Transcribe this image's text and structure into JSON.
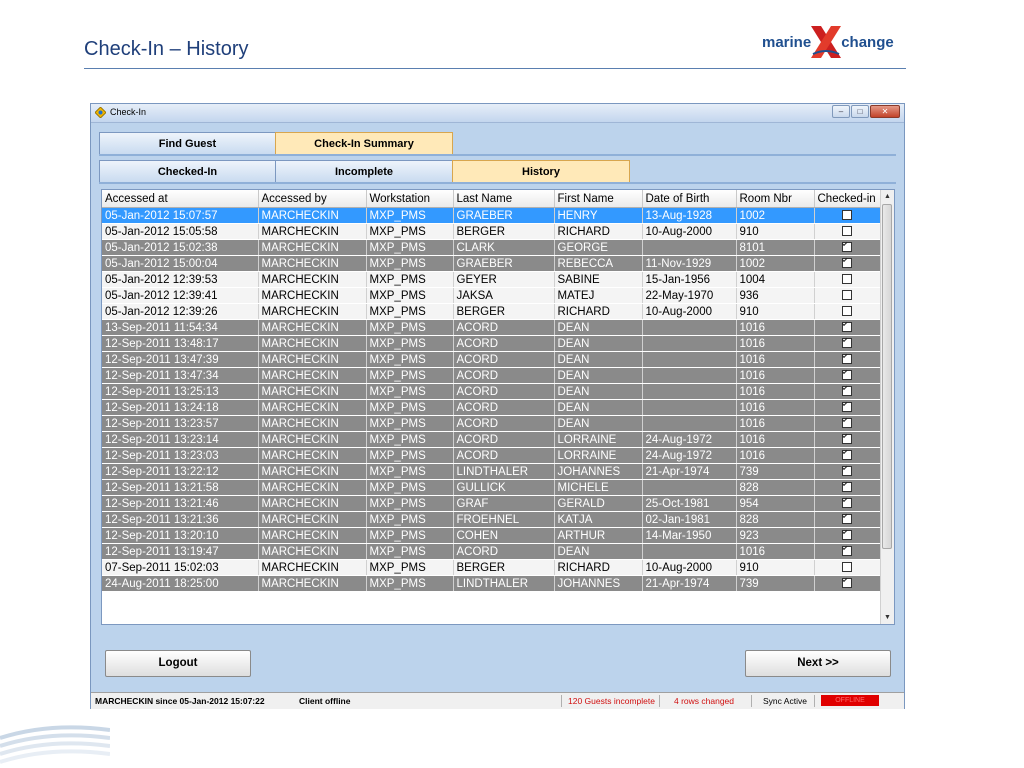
{
  "slide": {
    "title": "Check-In – History",
    "logo_left": "marine",
    "logo_right": "change"
  },
  "window": {
    "title": "Check-In",
    "controls": [
      "minimize-icon",
      "maximize-icon",
      "close-icon"
    ]
  },
  "tabs_top": [
    {
      "label": "Find Guest",
      "active": false
    },
    {
      "label": "Check-In Summary",
      "active": true
    }
  ],
  "tabs_sub": [
    {
      "label": "Checked-In",
      "active": false
    },
    {
      "label": "Incomplete",
      "active": false
    },
    {
      "label": "History",
      "active": true
    }
  ],
  "grid": {
    "columns": [
      "Accessed at",
      "Accessed by",
      "Workstation",
      "Last Name",
      "First Name",
      "Date of Birth",
      "Room Nbr",
      "Checked-in"
    ],
    "rows": [
      {
        "accessed_at": "05-Jan-2012 15:07:57",
        "accessed_by": "MARCHECKIN",
        "workstation": "MXP_PMS",
        "last": "GRAEBER",
        "first": "HENRY",
        "dob": "13-Aug-1928",
        "room": "1002",
        "checked": false,
        "style": "sel"
      },
      {
        "accessed_at": "05-Jan-2012 15:05:58",
        "accessed_by": "MARCHECKIN",
        "workstation": "MXP_PMS",
        "last": "BERGER",
        "first": "RICHARD",
        "dob": "10-Aug-2000",
        "room": "910",
        "checked": false,
        "style": "w"
      },
      {
        "accessed_at": "05-Jan-2012 15:02:38",
        "accessed_by": "MARCHECKIN",
        "workstation": "MXP_PMS",
        "last": "CLARK",
        "first": "GEORGE",
        "dob": "",
        "room": "8101",
        "checked": true,
        "style": "g"
      },
      {
        "accessed_at": "05-Jan-2012 15:00:04",
        "accessed_by": "MARCHECKIN",
        "workstation": "MXP_PMS",
        "last": "GRAEBER",
        "first": "REBECCA",
        "dob": "11-Nov-1929",
        "room": "1002",
        "checked": true,
        "style": "g"
      },
      {
        "accessed_at": "05-Jan-2012 12:39:53",
        "accessed_by": "MARCHECKIN",
        "workstation": "MXP_PMS",
        "last": "GEYER",
        "first": "SABINE",
        "dob": "15-Jan-1956",
        "room": "1004",
        "checked": false,
        "style": "w"
      },
      {
        "accessed_at": "05-Jan-2012 12:39:41",
        "accessed_by": "MARCHECKIN",
        "workstation": "MXP_PMS",
        "last": "JAKSA",
        "first": "MATEJ",
        "dob": "22-May-1970",
        "room": "936",
        "checked": false,
        "style": "w"
      },
      {
        "accessed_at": "05-Jan-2012 12:39:26",
        "accessed_by": "MARCHECKIN",
        "workstation": "MXP_PMS",
        "last": "BERGER",
        "first": "RICHARD",
        "dob": "10-Aug-2000",
        "room": "910",
        "checked": false,
        "style": "w"
      },
      {
        "accessed_at": "13-Sep-2011 11:54:34",
        "accessed_by": "MARCHECKIN",
        "workstation": "MXP_PMS",
        "last": "ACORD",
        "first": "DEAN",
        "dob": "",
        "room": "1016",
        "checked": true,
        "style": "g"
      },
      {
        "accessed_at": "12-Sep-2011 13:48:17",
        "accessed_by": "MARCHECKIN",
        "workstation": "MXP_PMS",
        "last": "ACORD",
        "first": "DEAN",
        "dob": "",
        "room": "1016",
        "checked": true,
        "style": "g"
      },
      {
        "accessed_at": "12-Sep-2011 13:47:39",
        "accessed_by": "MARCHECKIN",
        "workstation": "MXP_PMS",
        "last": "ACORD",
        "first": "DEAN",
        "dob": "",
        "room": "1016",
        "checked": true,
        "style": "g"
      },
      {
        "accessed_at": "12-Sep-2011 13:47:34",
        "accessed_by": "MARCHECKIN",
        "workstation": "MXP_PMS",
        "last": "ACORD",
        "first": "DEAN",
        "dob": "",
        "room": "1016",
        "checked": true,
        "style": "g"
      },
      {
        "accessed_at": "12-Sep-2011 13:25:13",
        "accessed_by": "MARCHECKIN",
        "workstation": "MXP_PMS",
        "last": "ACORD",
        "first": "DEAN",
        "dob": "",
        "room": "1016",
        "checked": true,
        "style": "g"
      },
      {
        "accessed_at": "12-Sep-2011 13:24:18",
        "accessed_by": "MARCHECKIN",
        "workstation": "MXP_PMS",
        "last": "ACORD",
        "first": "DEAN",
        "dob": "",
        "room": "1016",
        "checked": true,
        "style": "g"
      },
      {
        "accessed_at": "12-Sep-2011 13:23:57",
        "accessed_by": "MARCHECKIN",
        "workstation": "MXP_PMS",
        "last": "ACORD",
        "first": "DEAN",
        "dob": "",
        "room": "1016",
        "checked": true,
        "style": "g"
      },
      {
        "accessed_at": "12-Sep-2011 13:23:14",
        "accessed_by": "MARCHECKIN",
        "workstation": "MXP_PMS",
        "last": "ACORD",
        "first": "LORRAINE",
        "dob": "24-Aug-1972",
        "room": "1016",
        "checked": true,
        "style": "g"
      },
      {
        "accessed_at": "12-Sep-2011 13:23:03",
        "accessed_by": "MARCHECKIN",
        "workstation": "MXP_PMS",
        "last": "ACORD",
        "first": "LORRAINE",
        "dob": "24-Aug-1972",
        "room": "1016",
        "checked": true,
        "style": "g"
      },
      {
        "accessed_at": "12-Sep-2011 13:22:12",
        "accessed_by": "MARCHECKIN",
        "workstation": "MXP_PMS",
        "last": "LINDTHALER",
        "first": "JOHANNES",
        "dob": "21-Apr-1974",
        "room": "739",
        "checked": true,
        "style": "g"
      },
      {
        "accessed_at": "12-Sep-2011 13:21:58",
        "accessed_by": "MARCHECKIN",
        "workstation": "MXP_PMS",
        "last": "GULLICK",
        "first": "MICHELE",
        "dob": "",
        "room": "828",
        "checked": true,
        "style": "g"
      },
      {
        "accessed_at": "12-Sep-2011 13:21:46",
        "accessed_by": "MARCHECKIN",
        "workstation": "MXP_PMS",
        "last": "GRAF",
        "first": "GERALD",
        "dob": "25-Oct-1981",
        "room": "954",
        "checked": true,
        "style": "g"
      },
      {
        "accessed_at": "12-Sep-2011 13:21:36",
        "accessed_by": "MARCHECKIN",
        "workstation": "MXP_PMS",
        "last": "FROEHNEL",
        "first": "KATJA",
        "dob": "02-Jan-1981",
        "room": "828",
        "checked": true,
        "style": "g"
      },
      {
        "accessed_at": "12-Sep-2011 13:20:10",
        "accessed_by": "MARCHECKIN",
        "workstation": "MXP_PMS",
        "last": "COHEN",
        "first": "ARTHUR",
        "dob": "14-Mar-1950",
        "room": "923",
        "checked": true,
        "style": "g"
      },
      {
        "accessed_at": "12-Sep-2011 13:19:47",
        "accessed_by": "MARCHECKIN",
        "workstation": "MXP_PMS",
        "last": "ACORD",
        "first": "DEAN",
        "dob": "",
        "room": "1016",
        "checked": true,
        "style": "g"
      },
      {
        "accessed_at": "07-Sep-2011 15:02:03",
        "accessed_by": "MARCHECKIN",
        "workstation": "MXP_PMS",
        "last": "BERGER",
        "first": "RICHARD",
        "dob": "10-Aug-2000",
        "room": "910",
        "checked": false,
        "style": "w"
      },
      {
        "accessed_at": "24-Aug-2011 18:25:00",
        "accessed_by": "MARCHECKIN",
        "workstation": "MXP_PMS",
        "last": "LINDTHALER",
        "first": "JOHANNES",
        "dob": "21-Apr-1974",
        "room": "739",
        "checked": true,
        "style": "g"
      }
    ]
  },
  "buttons": {
    "logout": "Logout",
    "next": "Next >>"
  },
  "status": {
    "user": "MARCHECKIN since 05-Jan-2012 15:07:22",
    "client": "Client offline",
    "incomplete": "120 Guests incomplete",
    "changed": "4 rows changed",
    "sync": "Sync Active",
    "offline_badge": "OFFLINE"
  },
  "colors": {
    "selected_row": "#3399ff",
    "highlight_row": "#8a8a8a",
    "active_tab": "#ffe9b8",
    "status_alert": "#e00000"
  }
}
